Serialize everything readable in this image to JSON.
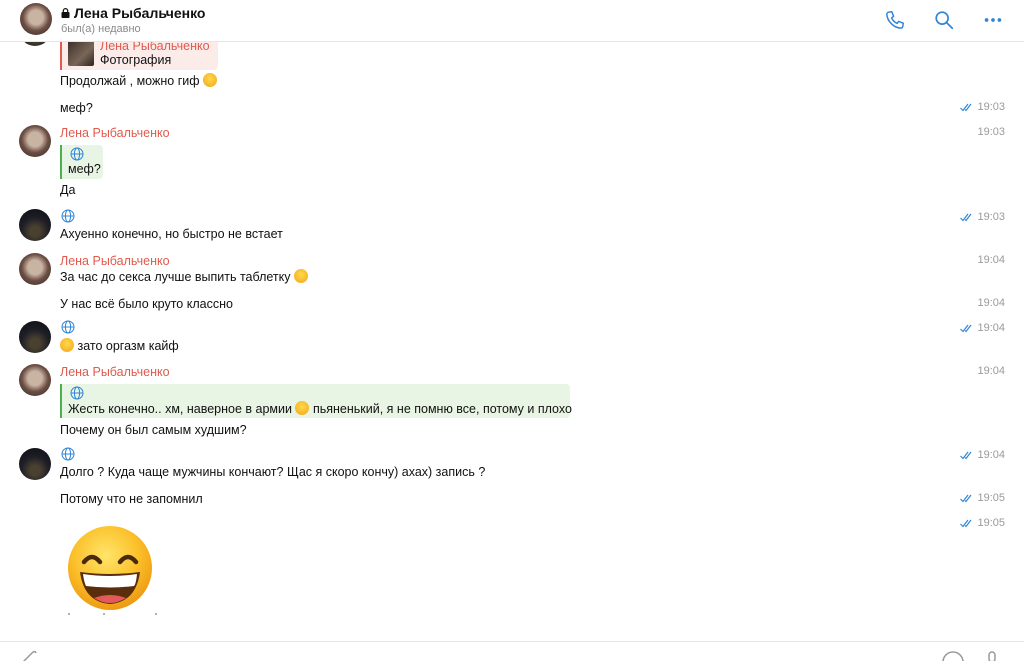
{
  "header": {
    "contact_name": "Лена Рыбальченко",
    "status": "был(а) недавно"
  },
  "icons": {
    "lock": "lock-icon",
    "call": "phone-icon",
    "search": "search-icon",
    "more": "more-icon",
    "read": "double-check-icon",
    "globe": "globe-icon"
  },
  "colors": {
    "sender": "#e05a4e",
    "accent": "#2f85d6",
    "quote_green": "#4cb050"
  },
  "messages": {
    "m0": {
      "quote_sender": "Лена Рыбальченко",
      "quote_text": "Фотография"
    },
    "m1": {
      "text": "Продолжай , можно гиф"
    },
    "m2": {
      "text": "меф?",
      "time": "19:03"
    },
    "m3": {
      "sender": "Лена Рыбальченко",
      "time": "19:03",
      "quote_text": "меф?",
      "text": "Да"
    },
    "m4": {
      "text": "Ахуенно конечно, но быстро не встает",
      "time": "19:03"
    },
    "m5": {
      "sender": "Лена Рыбальченко",
      "text": "За час до секса лучше выпить таблетку",
      "time": "19:04"
    },
    "m6": {
      "text": "У нас всё было круто классно",
      "time": "19:04"
    },
    "m7": {
      "text": "зато оргазм кайф",
      "time": "19:04"
    },
    "m8": {
      "sender": "Лена Рыбальченко",
      "time": "19:04",
      "quote_text_a": "Жесть конечно.. хм, наверное в армии",
      "quote_text_b": "пьяненький, я не помню все, потому и плохо",
      "text": "Почему он был самым худшим?"
    },
    "m9": {
      "text": "Долго ? Куда чаще мужчины кончают? Щас я скоро кончу) ахах) запись ?",
      "time": "19:04"
    },
    "m10": {
      "text": "Потому что не запомнил",
      "time": "19:05"
    },
    "m11": {
      "time": "19:05",
      "sticker": "grinning-face-sticker"
    }
  }
}
